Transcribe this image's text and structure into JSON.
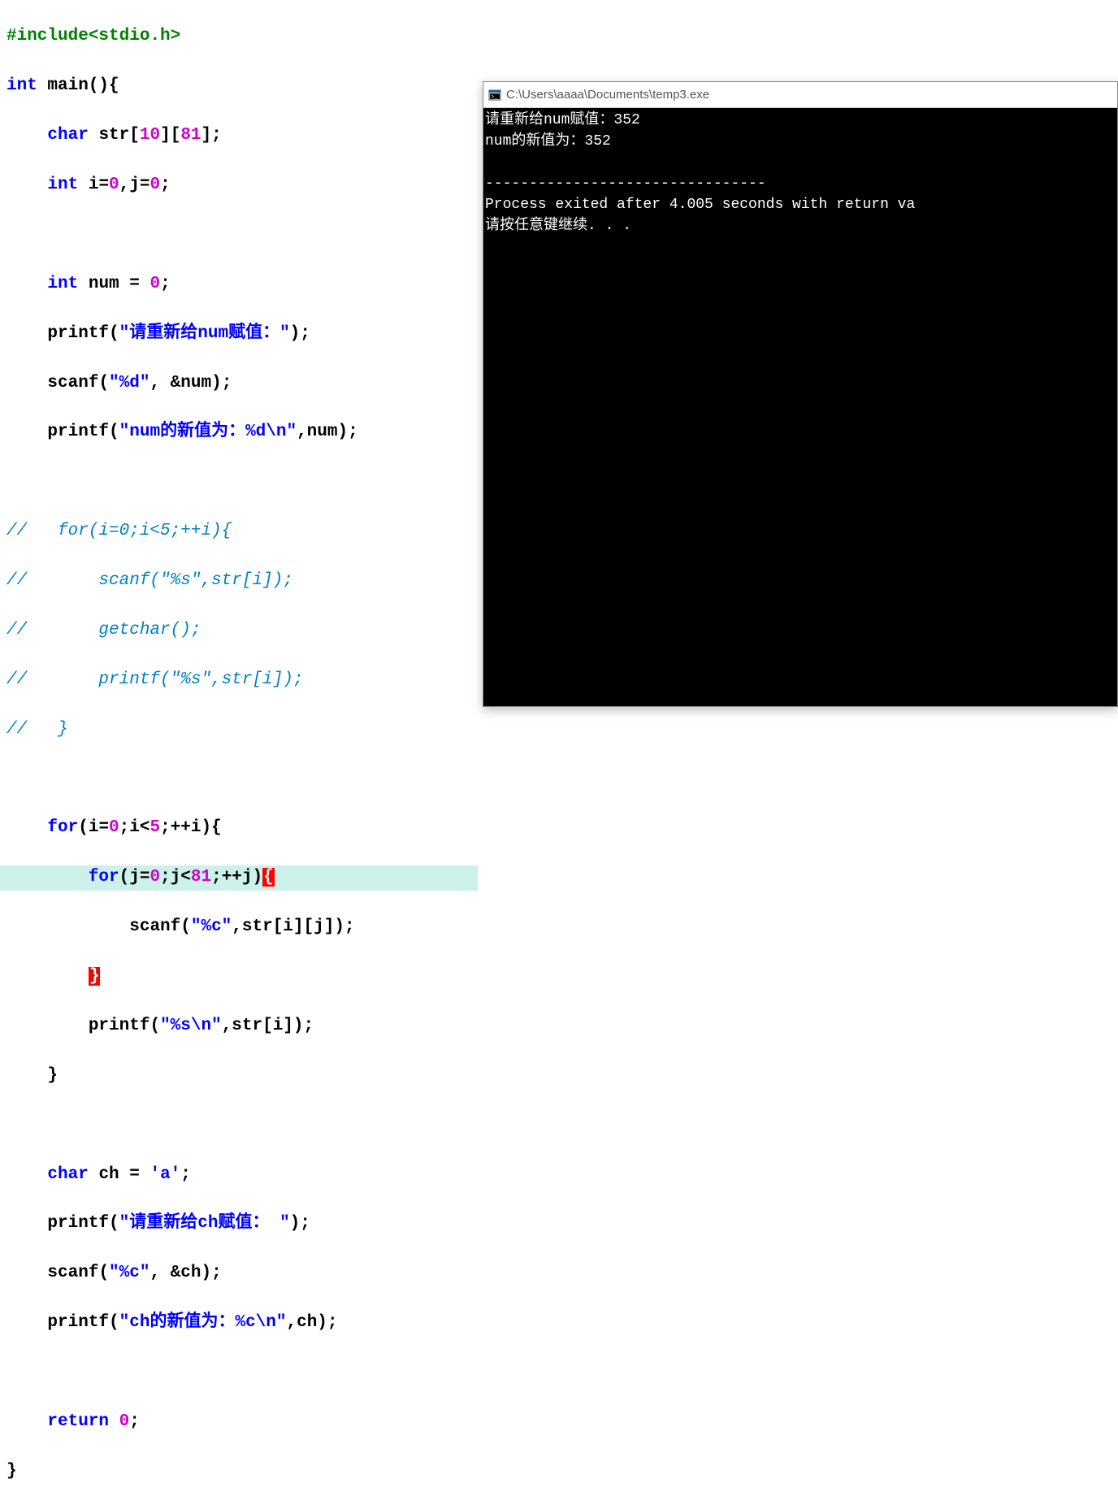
{
  "code": {
    "l1_include": "#include",
    "l1_header": "<stdio.h>",
    "l2_kw_int": "int",
    "l2_main": " main",
    "l2_paren": "(){",
    "l3_kw_char": "char",
    "l3_str": " str",
    "l3_b1o": "[",
    "l3_n10": "10",
    "l3_b1c": "]",
    "l3_b2o": "[",
    "l3_n81": "81",
    "l3_b2c": "]",
    "l3_semi": ";",
    "l4_kw_int": "int",
    "l4_i": " i=",
    "l4_z1": "0",
    "l4_j": ",j=",
    "l4_z2": "0",
    "l4_semi": ";",
    "l6_kw_int": "int",
    "l6_num": " num = ",
    "l6_z": "0",
    "l6_semi": ";",
    "l7_printf": "printf",
    "l7_open": "(",
    "l7_str": "\"请重新给num赋值：\"",
    "l7_close": ");",
    "l8_scanf": "scanf",
    "l8_open": "(",
    "l8_str": "\"%d\"",
    "l8_mid": ", &num",
    "l8_close": ");",
    "l9_printf": "printf",
    "l9_open": "(",
    "l9_str": "\"num的新值为：%d\\n\"",
    "l9_mid": ",num",
    "l9_close": ");",
    "l11_c": "//   for(i=0;i<5;++i){",
    "l12_c": "//       scanf(\"%s\",str[i]);",
    "l13_c": "//       getchar();",
    "l14_c": "//       printf(\"%s\",str[i]);",
    "l15_c": "//   }",
    "l17_for": "for",
    "l17_open": "(i=",
    "l17_z": "0",
    "l17_cond": ";i<",
    "l17_five": "5",
    "l17_inc": ";++i){",
    "l18_for": "for",
    "l18_open": "(j=",
    "l18_z": "0",
    "l18_cond": ";j<",
    "l18_81": "81",
    "l18_inc": ";++j)",
    "l18_brace": "{",
    "l19_scanf": "scanf",
    "l19_open": "(",
    "l19_str": "\"%c\"",
    "l19_mid": ",str[i][j]",
    "l19_close": ");",
    "l20_brace": "}",
    "l21_printf": "printf",
    "l21_open": "(",
    "l21_str": "\"%s\\n\"",
    "l21_mid": ",str[i]",
    "l21_close": ");",
    "l22_close": "}",
    "l24_kw_char": "char",
    "l24_ch": " ch = ",
    "l24_lit": "'a'",
    "l24_semi": ";",
    "l25_printf": "printf",
    "l25_open": "(",
    "l25_str": "\"请重新给ch赋值： \"",
    "l25_close": ");",
    "l26_scanf": "scanf",
    "l26_open": "(",
    "l26_str": "\"%c\"",
    "l26_mid": ", &ch",
    "l26_close": ");",
    "l27_printf": "printf",
    "l27_open": "(",
    "l27_str": "\"ch的新值为：%c\\n\"",
    "l27_mid": ",ch",
    "l27_close": ");",
    "l29_ret": "return",
    "l29_sp": " ",
    "l29_z": "0",
    "l29_semi": ";",
    "l30_close": "}"
  },
  "console": {
    "title": "C:\\Users\\aaaa\\Documents\\temp3.exe",
    "line1": "请重新给num赋值：352",
    "line2": "num的新值为：352",
    "blank": "",
    "divider": "--------------------------------",
    "line4": "Process exited after 4.005 seconds with return va",
    "line5": "请按任意键继续. . ."
  }
}
